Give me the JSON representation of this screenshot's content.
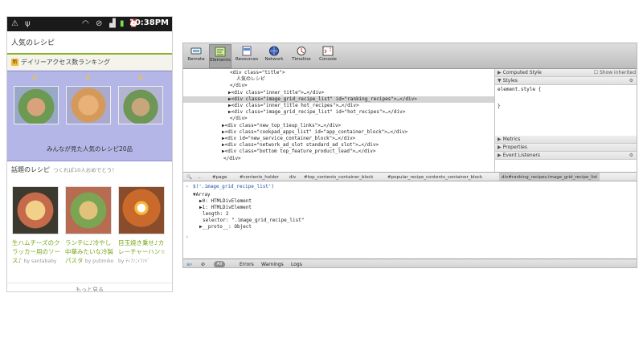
{
  "phone": {
    "status_bar": {
      "time": "10:38PM"
    },
    "page_title": "人気のレシピ",
    "ranking": {
      "heading": "デイリーアクセス数ランキング",
      "badge": "新",
      "caption": "みんなが見た人気のレシピ20品"
    },
    "featured": {
      "heading": "話題のレシピ",
      "subheading": "つくれぽ10人おめでとう！",
      "recipes": [
        {
          "title": "生ハムチーズのクラッカー用のソース♪",
          "author": "by santababy"
        },
        {
          "title": "ランチに♪冷やし中華みたいな冷製パスタ",
          "author": "by putimiko"
        },
        {
          "title": "目玉焼き乗せ♪カレーチャーハン☆",
          "author": "by ﾃｨﾌｧﾆｨﾌｧﾄﾞ"
        }
      ]
    },
    "more_link": "もっと見る"
  },
  "devtools": {
    "toolbar": [
      {
        "label": "Remote",
        "icon": "remote-icon"
      },
      {
        "label": "Elements",
        "icon": "elements-icon"
      },
      {
        "label": "Resources",
        "icon": "resources-icon"
      },
      {
        "label": "Network",
        "icon": "network-icon"
      },
      {
        "label": "Timeline",
        "icon": "timeline-icon"
      },
      {
        "label": "Console",
        "icon": "console-icon"
      }
    ],
    "elements": [
      {
        "text": "<div class=\"title\">"
      },
      {
        "text": "人気のレシピ"
      },
      {
        "text": "</div>"
      },
      {
        "text": "▶<div class=\"inner_title\">…</div>"
      },
      {
        "text": "▶<div class=\"image_grid_recipe_list\" id=\"ranking_recipes\">…</div>"
      },
      {
        "text": "▶<div class=\"inner_title hot_recipes\">…</div>"
      },
      {
        "text": "▶<div class=\"image_grid_recipe_list\" id=\"hot_recipes\">…</div>"
      },
      {
        "text": "</div>"
      },
      {
        "text": "▶<div class=\"new_top_tieup_links\">…</div>"
      },
      {
        "text": "▶<div class=\"cookpad_apps_list\" id=\"app_container_block\">…</div>"
      },
      {
        "text": "▶<div id=\"new_service_container_block\">…</div>"
      },
      {
        "text": "▶<div class=\"network_ad_slot standard_ad_slot\">…</div>"
      },
      {
        "text": "▶<div class=\"bottom top_feature_product_lead\">…</div>"
      },
      {
        "text": "</div>"
      }
    ],
    "sidebar": {
      "computed_style": "Computed Style",
      "show_inherited": "Show inherited",
      "styles": "Styles",
      "element_style_open": "element.style {",
      "element_style_close": "}",
      "metrics": "Metrics",
      "properties": "Properties",
      "event_listeners": "Event Listeners"
    },
    "breadcrumbs": [
      "...",
      "#page",
      "#contents_holder",
      "div",
      "#top_contents_container_block",
      "#popular_recipe_contents_container_block",
      "div#ranking_recipes.image_grid_recipe_list"
    ],
    "console": [
      {
        "text": "$('.image_grid_recipe_list')"
      },
      {
        "text": "▼Array"
      },
      {
        "text": "▶0: HTMLDivElement"
      },
      {
        "text": "▶1: HTMLDivElement"
      },
      {
        "text": "length: 2"
      },
      {
        "text": "selector: \".image_grid_recipe_list\""
      },
      {
        "text": "▶__proto__: Object"
      },
      {
        "text": "›"
      }
    ],
    "status_bar": {
      "all": "All",
      "errors": "Errors",
      "warnings": "Warnings",
      "logs": "Logs"
    }
  }
}
